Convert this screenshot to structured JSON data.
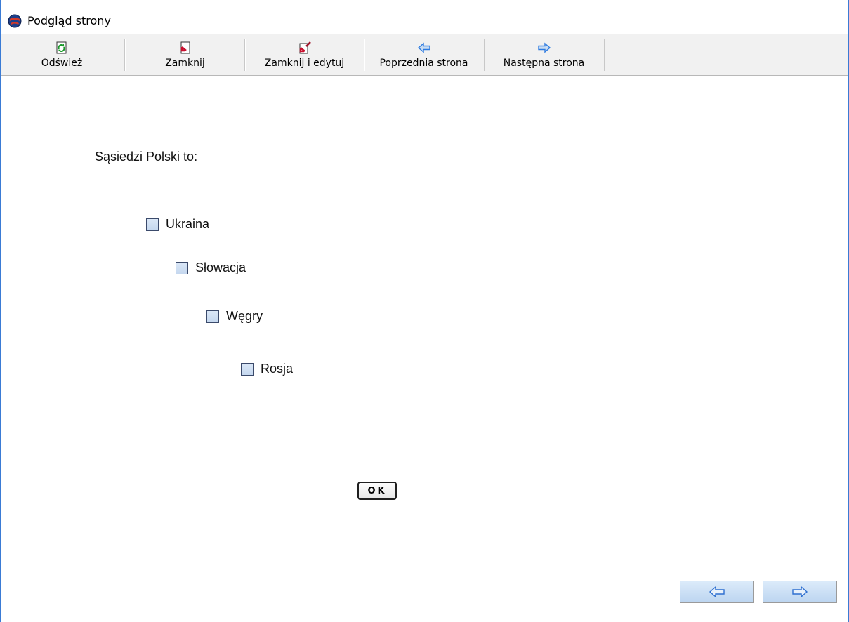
{
  "window": {
    "title": "Podgląd strony",
    "icon": "app-globe-icon"
  },
  "toolbar": {
    "buttons": [
      {
        "label": "Odśwież",
        "icon": "refresh-icon"
      },
      {
        "label": "Zamknij",
        "icon": "close-doc-icon"
      },
      {
        "label": "Zamknij i edytuj",
        "icon": "close-edit-icon"
      },
      {
        "label": "Poprzednia strona",
        "icon": "arrow-left-icon"
      },
      {
        "label": "Następna strona",
        "icon": "arrow-right-icon"
      }
    ]
  },
  "quiz": {
    "question": "Sąsiedzi Polski to:",
    "options": [
      {
        "label": "Ukraina",
        "checked": false
      },
      {
        "label": "Słowacja",
        "checked": false
      },
      {
        "label": "Węgry",
        "checked": false
      },
      {
        "label": "Rosja",
        "checked": false
      }
    ],
    "ok_label": "OK"
  },
  "nav": {
    "prev_icon": "arrow-left-icon",
    "next_icon": "arrow-right-icon"
  },
  "colors": {
    "toolbar_bg": "#f1f1f1",
    "arrow_fill": "#2e7be0",
    "nav_button_bg": "#c9ddf3"
  }
}
